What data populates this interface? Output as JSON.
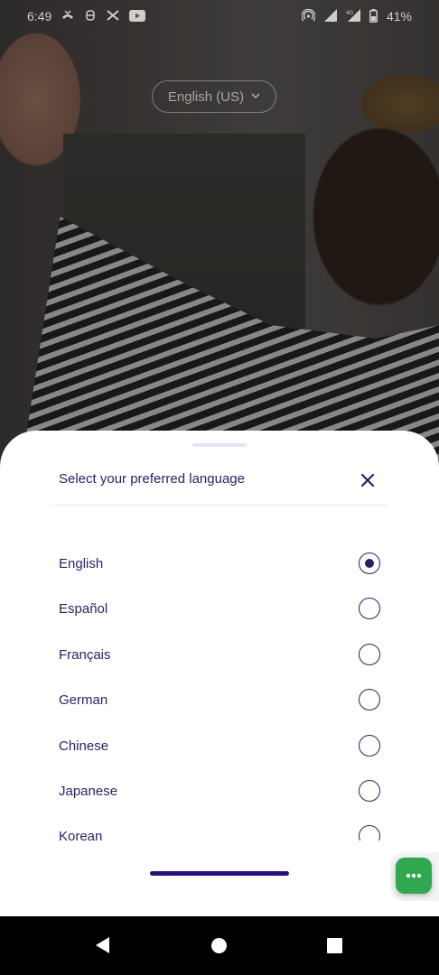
{
  "status_bar": {
    "time": "6:49",
    "battery": "41%",
    "icons_left": [
      "missed-call-icon",
      "vpn-icon",
      "tools-icon",
      "youtube-icon"
    ],
    "icons_right": [
      "hotspot-icon",
      "signal-icon",
      "signal-4g-icon",
      "battery-icon"
    ]
  },
  "header": {
    "language_pill": "English (US)"
  },
  "sheet": {
    "title": "Select your preferred language",
    "languages": [
      {
        "label": "English",
        "selected": true
      },
      {
        "label": "Español",
        "selected": false
      },
      {
        "label": "Français",
        "selected": false
      },
      {
        "label": "German",
        "selected": false
      },
      {
        "label": "Chinese",
        "selected": false
      },
      {
        "label": "Japanese",
        "selected": false
      },
      {
        "label": "Korean",
        "selected": false
      }
    ]
  },
  "colors": {
    "primary": "#2a1f66",
    "chat_fab": "#2fa84f",
    "home_indicator": "#2a0f7a"
  }
}
